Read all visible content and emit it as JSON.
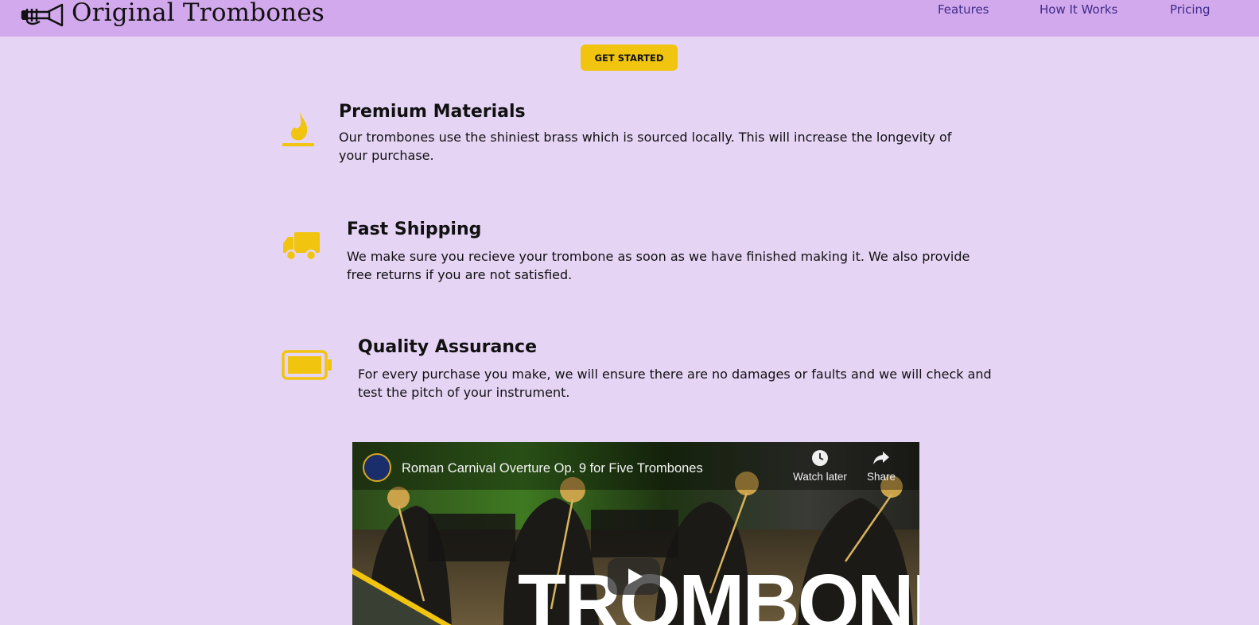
{
  "header": {
    "brand": "Original Trombones",
    "nav": {
      "features": "Features",
      "how_it_works": "How It Works",
      "pricing": "Pricing"
    }
  },
  "cta": {
    "label": "GET STARTED"
  },
  "features": [
    {
      "icon": "flame-icon",
      "title": "Premium Materials",
      "description": "Our trombones use the shiniest brass which is sourced locally. This will increase the longevity of your purchase."
    },
    {
      "icon": "truck-icon",
      "title": "Fast Shipping",
      "description": "We make sure you recieve your trombone as soon as we have finished making it. We also provide free returns if you are not satisfied."
    },
    {
      "icon": "battery-full-icon",
      "title": "Quality Assurance",
      "description": "For every purchase you make, we will ensure there are no damages or faults and we will check and test the pitch of your instrument."
    }
  ],
  "video": {
    "title": "Roman Carnival Overture Op. 9 for Five Trombones",
    "watch_later": "Watch later",
    "share": "Share",
    "overlay_text": "TROMBONE"
  },
  "colors": {
    "background": "#e6d4f5",
    "header": "#d2a9ec",
    "accent": "#f1c40f",
    "nav_link": "#3d2b8a"
  }
}
